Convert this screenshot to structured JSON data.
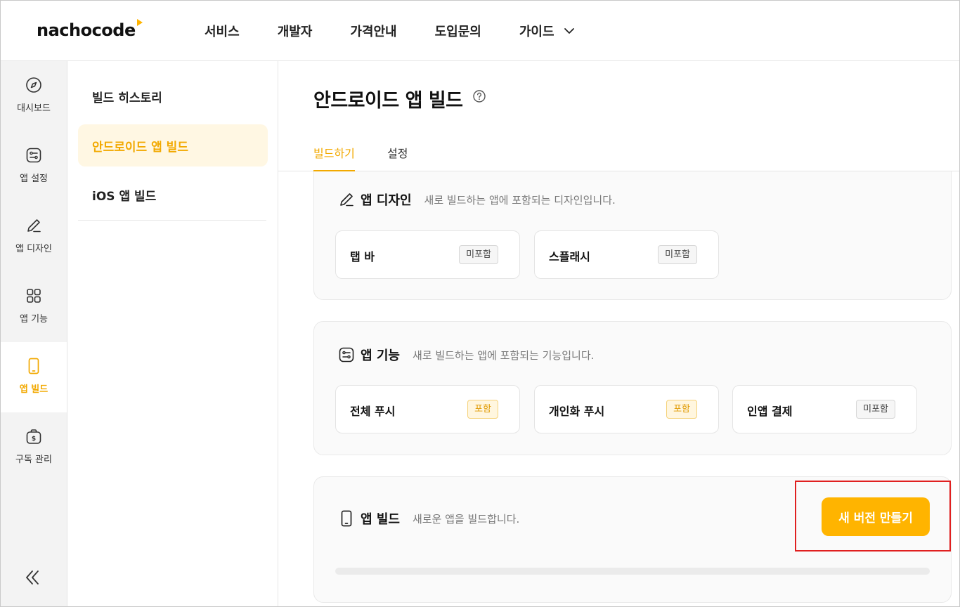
{
  "app": {
    "logo": "nachocode",
    "accent_color": "#ffb400"
  },
  "topnav": {
    "items": [
      "서비스",
      "개발자",
      "가격안내",
      "도입문의",
      "가이드"
    ]
  },
  "rail": {
    "items": [
      {
        "label": "대시보드",
        "icon": "compass-icon"
      },
      {
        "label": "앱 설정",
        "icon": "settings-toggle-icon"
      },
      {
        "label": "앱 디자인",
        "icon": "pen-icon"
      },
      {
        "label": "앱 기능",
        "icon": "grid-icon"
      },
      {
        "label": "앱 빌드",
        "icon": "phone-icon",
        "active": true
      },
      {
        "label": "구독 관리",
        "icon": "dollar-bag-icon"
      }
    ],
    "collapse_icon": "double-chevron-left-icon"
  },
  "submenu": {
    "items": [
      "빌드 히스토리",
      "안드로이드 앱 빌드",
      "iOS 앱 빌드"
    ],
    "active_index": 1
  },
  "page": {
    "title": "안드로이드 앱 빌드",
    "tabs": [
      "빌드하기",
      "설정"
    ],
    "active_tab": 0
  },
  "design_card": {
    "title": "앱 디자인",
    "description": "새로 빌드하는 앱에 포함되는 디자인입니다.",
    "options": [
      {
        "label": "탭 바",
        "badge": "미포함"
      },
      {
        "label": "스플래시",
        "badge": "미포함"
      }
    ]
  },
  "feature_card": {
    "title": "앱 기능",
    "description": "새로 빌드하는 앱에 포함되는 기능입니다.",
    "options": [
      {
        "label": "전체 푸시",
        "badge": "포함"
      },
      {
        "label": "개인화 푸시",
        "badge": "포함"
      },
      {
        "label": "인앱 결제",
        "badge": "미포함"
      }
    ]
  },
  "build_card": {
    "title": "앱 빌드",
    "description": "새로운 앱을 빌드합니다.",
    "button_label": "새 버전 만들기"
  }
}
